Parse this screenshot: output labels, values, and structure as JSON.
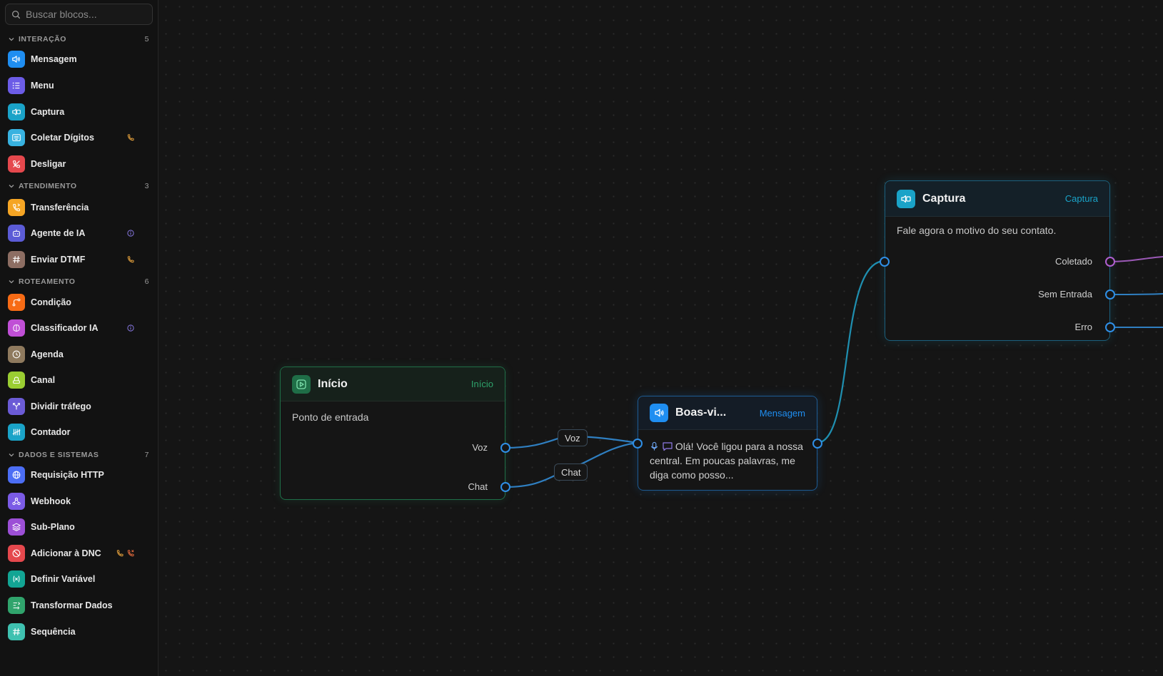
{
  "sidebar": {
    "search_placeholder": "Buscar blocos...",
    "sections": [
      {
        "title": "INTERAÇÃO",
        "count": "5",
        "items": [
          {
            "label": "Mensagem",
            "icon": "speaker-icon",
            "color": "#1f8ef1"
          },
          {
            "label": "Menu",
            "icon": "list-icon",
            "color": "#6c5ce7"
          },
          {
            "label": "Captura",
            "icon": "capture-icon",
            "color": "#1aa3c8"
          },
          {
            "label": "Coletar Dígitos",
            "icon": "keypad-icon",
            "color": "#38b2e0",
            "badges": [
              "phone-icon"
            ]
          },
          {
            "label": "Desligar",
            "icon": "hangup-icon",
            "color": "#e5484d"
          }
        ]
      },
      {
        "title": "ATENDIMENTO",
        "count": "3",
        "items": [
          {
            "label": "Transferência",
            "icon": "transfer-icon",
            "color": "#f5a524"
          },
          {
            "label": "Agente de IA",
            "icon": "robot-icon",
            "color": "#5b5bd6",
            "badges": [
              "info-icon"
            ]
          },
          {
            "label": "Enviar DTMF",
            "icon": "hash-icon",
            "color": "#8d6e63",
            "badges": [
              "phone-icon"
            ]
          }
        ]
      },
      {
        "title": "ROTEAMENTO",
        "count": "6",
        "items": [
          {
            "label": "Condição",
            "icon": "branch-icon",
            "color": "#f76b15"
          },
          {
            "label": "Classificador IA",
            "icon": "brain-icon",
            "color": "#c04fd6",
            "badges": [
              "info-icon"
            ]
          },
          {
            "label": "Agenda",
            "icon": "clock-icon",
            "color": "#8f7a5e"
          },
          {
            "label": "Canal",
            "icon": "channel-icon",
            "color": "#9acd32"
          },
          {
            "label": "Dividir tráfego",
            "icon": "split-icon",
            "color": "#6b5bd6"
          },
          {
            "label": "Contador",
            "icon": "tally-icon",
            "color": "#1aa3c8"
          }
        ]
      },
      {
        "title": "DADOS E SISTEMAS",
        "count": "7",
        "items": [
          {
            "label": "Requisição HTTP",
            "icon": "globe-icon",
            "color": "#4c6ef5"
          },
          {
            "label": "Webhook",
            "icon": "webhook-icon",
            "color": "#7b5be6"
          },
          {
            "label": "Sub-Plano",
            "icon": "layers-icon",
            "color": "#9c4fd6"
          },
          {
            "label": "Adicionar à DNC",
            "icon": "block-icon",
            "color": "#e5484d",
            "badges": [
              "phone-icon",
              "phone-missed-icon"
            ]
          },
          {
            "label": "Definir Variável",
            "icon": "variable-icon",
            "color": "#12a594"
          },
          {
            "label": "Transformar Dados",
            "icon": "transform-icon",
            "color": "#30a46c"
          },
          {
            "label": "Sequência",
            "icon": "hash-icon",
            "color": "#3fc1b0"
          }
        ]
      }
    ]
  },
  "canvas": {
    "nodes": {
      "inicio": {
        "title": "Início",
        "type": "Início",
        "description": "Ponto de entrada",
        "outputs": [
          "Voz",
          "Chat"
        ],
        "accent": "#2ea36b"
      },
      "boas_vindas": {
        "title": "Boas-vi...",
        "type": "Mensagem",
        "message": "Olá! Você ligou para a nossa central. Em poucas palavras, me diga como posso...",
        "accent": "#1f8ef1"
      },
      "captura": {
        "title": "Captura",
        "type": "Captura",
        "description": "Fale agora o motivo do seu contato.",
        "outputs": [
          "Coletado",
          "Sem Entrada",
          "Erro"
        ],
        "accent": "#1aa3c8"
      }
    },
    "edge_labels": [
      "Voz",
      "Chat"
    ]
  }
}
